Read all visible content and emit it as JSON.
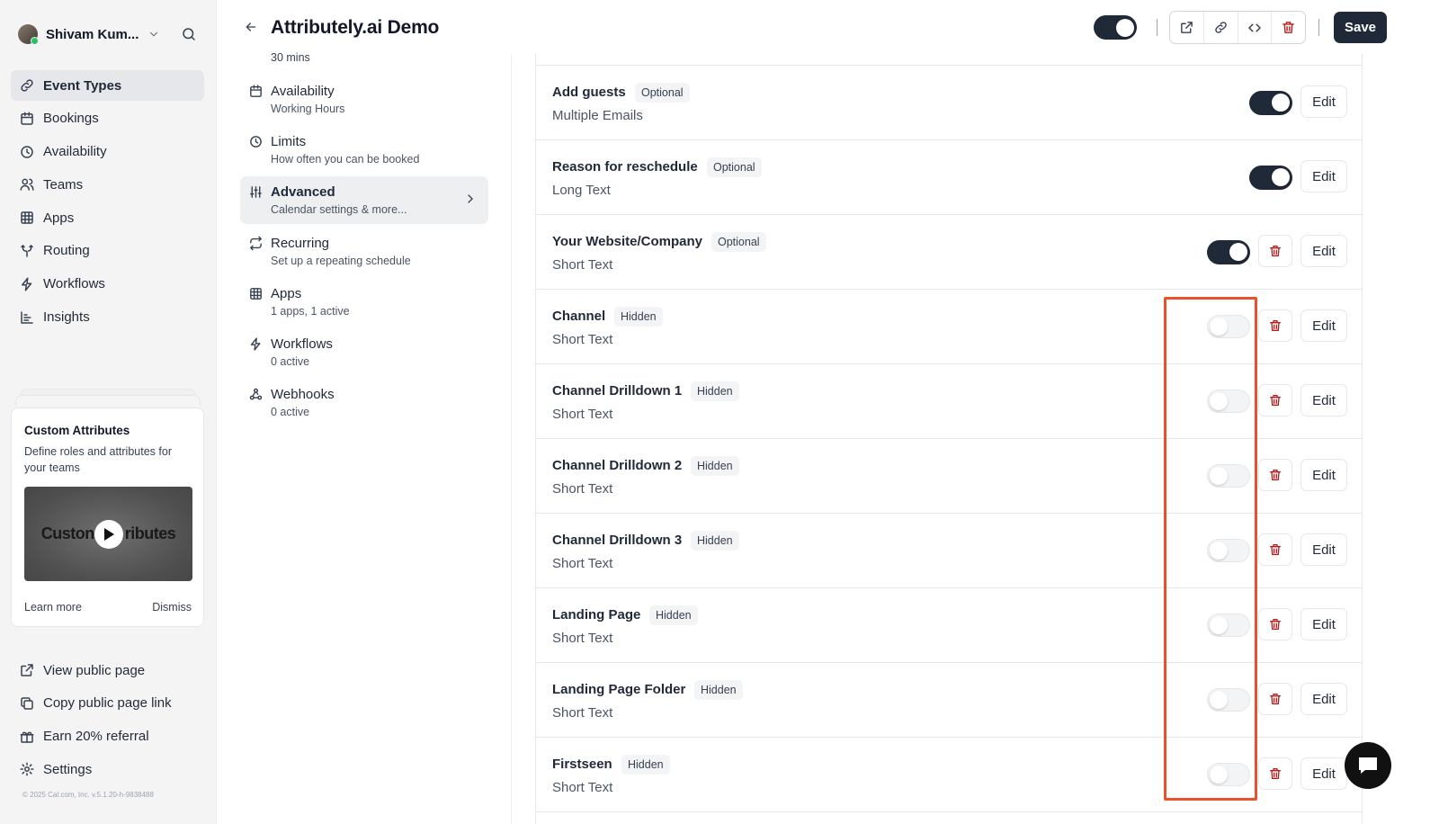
{
  "user": {
    "name": "Shivam Kum..."
  },
  "sidebar": {
    "items": [
      {
        "label": "Event Types",
        "icon": "link-icon",
        "active": true
      },
      {
        "label": "Bookings",
        "icon": "calendar-icon"
      },
      {
        "label": "Availability",
        "icon": "clock-icon"
      },
      {
        "label": "Teams",
        "icon": "users-icon"
      },
      {
        "label": "Apps",
        "icon": "grid-icon"
      },
      {
        "label": "Routing",
        "icon": "split-icon"
      },
      {
        "label": "Workflows",
        "icon": "zap-icon"
      },
      {
        "label": "Insights",
        "icon": "bar-chart-icon"
      }
    ],
    "promo": {
      "title": "Custom Attributes",
      "description": "Define roles and attributes for your teams",
      "video_text_left": "Custon",
      "video_text_right": "ributes",
      "learn_more": "Learn more",
      "dismiss": "Dismiss"
    },
    "bottom_items": [
      {
        "label": "View public page",
        "icon": "external-link-icon"
      },
      {
        "label": "Copy public page link",
        "icon": "copy-icon"
      },
      {
        "label": "Earn 20% referral",
        "icon": "gift-icon"
      },
      {
        "label": "Settings",
        "icon": "gear-icon"
      }
    ],
    "copyright": "© 2025 Cal.com, Inc. v.5.1.20-h-9838488"
  },
  "header": {
    "title": "Attributely.ai Demo",
    "hidden_toggle_on": true,
    "save_label": "Save"
  },
  "settings_nav": {
    "top_sub": "30 mins",
    "items": [
      {
        "label": "Availability",
        "sub": "Working Hours",
        "icon": "calendar-icon"
      },
      {
        "label": "Limits",
        "sub": "How often you can be booked",
        "icon": "clock-icon"
      },
      {
        "label": "Advanced",
        "sub": "Calendar settings & more...",
        "icon": "sliders-icon",
        "active": true
      },
      {
        "label": "Recurring",
        "sub": "Set up a repeating schedule",
        "icon": "repeat-icon"
      },
      {
        "label": "Apps",
        "sub": "1 apps, 1 active",
        "icon": "grid-icon"
      },
      {
        "label": "Workflows",
        "sub": "0 active",
        "icon": "zap-icon"
      },
      {
        "label": "Webhooks",
        "sub": "0 active",
        "icon": "webhook-icon"
      }
    ]
  },
  "questions": [
    {
      "label": "Add guests",
      "badge": "Optional",
      "type": "Multiple Emails",
      "enabled": true,
      "deletable": false
    },
    {
      "label": "Reason for reschedule",
      "badge": "Optional",
      "type": "Long Text",
      "enabled": true,
      "deletable": false
    },
    {
      "label": "Your Website/Company",
      "badge": "Optional",
      "type": "Short Text",
      "enabled": true,
      "deletable": true
    },
    {
      "label": "Channel",
      "badge": "Hidden",
      "type": "Short Text",
      "enabled": false,
      "deletable": true
    },
    {
      "label": "Channel Drilldown 1",
      "badge": "Hidden",
      "type": "Short Text",
      "enabled": false,
      "deletable": true
    },
    {
      "label": "Channel Drilldown 2",
      "badge": "Hidden",
      "type": "Short Text",
      "enabled": false,
      "deletable": true
    },
    {
      "label": "Channel Drilldown 3",
      "badge": "Hidden",
      "type": "Short Text",
      "enabled": false,
      "deletable": true
    },
    {
      "label": "Landing Page",
      "badge": "Hidden",
      "type": "Short Text",
      "enabled": false,
      "deletable": true
    },
    {
      "label": "Landing Page Folder",
      "badge": "Hidden",
      "type": "Short Text",
      "enabled": false,
      "deletable": true
    },
    {
      "label": "Firstseen",
      "badge": "Hidden",
      "type": "Short Text",
      "enabled": false,
      "deletable": true
    }
  ],
  "edit_label": "Edit",
  "colors": {
    "accent_dark": "#1f2937",
    "highlight": "#e8512a",
    "delete": "#b91c1c"
  }
}
